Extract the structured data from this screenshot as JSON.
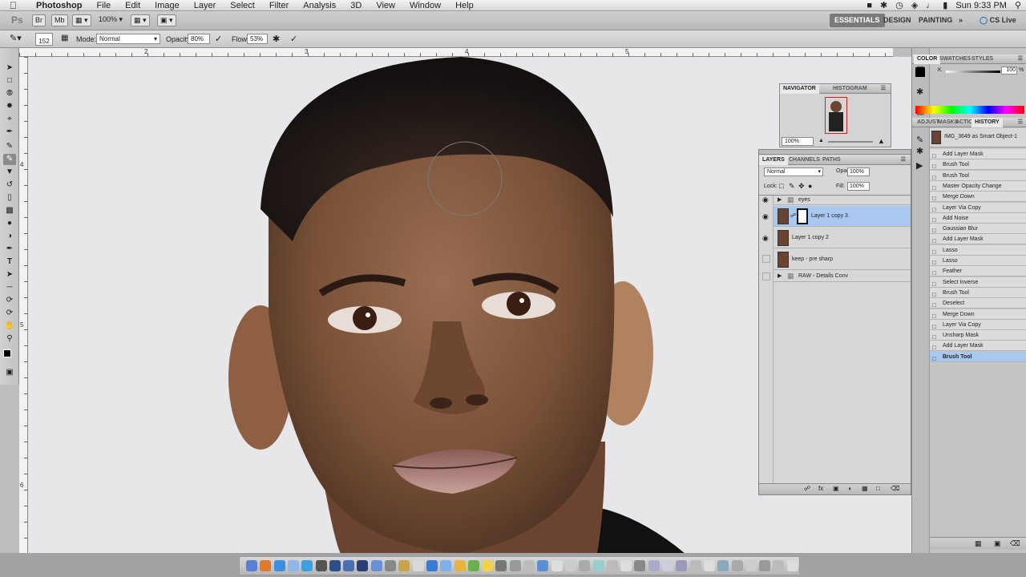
{
  "menubar": {
    "app_name": "Photoshop",
    "items": [
      "File",
      "Edit",
      "Image",
      "Layer",
      "Select",
      "Filter",
      "Analysis",
      "3D",
      "View",
      "Window",
      "Help"
    ],
    "clock": "Sun 9:33 PM"
  },
  "appbar": {
    "zoom": "100%",
    "workspaces": [
      "ESSENTIALS",
      "DESIGN",
      "PAINTING"
    ],
    "overflow": "»",
    "cs_live": "CS Live"
  },
  "options": {
    "brush_size": "152",
    "mode_label": "Mode:",
    "mode_value": "Normal",
    "opacity_label": "Opacity:",
    "opacity_value": "80%",
    "flow_label": "Flow:",
    "flow_value": "53%"
  },
  "ruler_h": [
    "2",
    "3",
    "4",
    "5"
  ],
  "ruler_v": [
    "4",
    "5",
    "6"
  ],
  "navigator": {
    "tabs": [
      "NAVIGATOR",
      "HISTOGRAM"
    ],
    "zoom": "100%"
  },
  "color_panel": {
    "tabs": [
      "COLOR",
      "SWATCHES",
      "STYLES"
    ],
    "channel": "K",
    "value": "100",
    "unit": "%"
  },
  "history_panel": {
    "tabs": [
      "ADJUST",
      "MASKS",
      "ACTION",
      "HISTORY"
    ],
    "snapshot": "IMG_3649 as Smart Object-1",
    "items": [
      "Add Layer Mask",
      "Brush Tool",
      "Brush Tool",
      "Master Opacity Change",
      "Merge Down",
      "Layer Via Copy",
      "Add Noise",
      "Gaussian Blur",
      "Add Layer Mask",
      "Lasso",
      "Lasso",
      "Feather",
      "Select Inverse",
      "Brush Tool",
      "Deselect",
      "Merge Down",
      "Layer Via Copy",
      "Unsharp Mask",
      "Add Layer Mask",
      "Brush Tool"
    ],
    "selected_index": 19
  },
  "layers_panel": {
    "tabs": [
      "LAYERS",
      "CHANNELS",
      "PATHS"
    ],
    "blend_mode": "Normal",
    "opacity_label": "Opacity:",
    "opacity_value": "100%",
    "lock_label": "Lock:",
    "fill_label": "Fill:",
    "fill_value": "100%",
    "layers": [
      {
        "name": "eyes",
        "type": "group",
        "visible": true
      },
      {
        "name": "Layer 1 copy 3",
        "type": "layer",
        "visible": true,
        "selected": true
      },
      {
        "name": "Layer 1 copy 2",
        "type": "layer",
        "visible": true
      },
      {
        "name": "keep - pre sharp",
        "type": "layer",
        "visible": false
      },
      {
        "name": "RAW - Details Conv",
        "type": "group",
        "visible": false
      }
    ]
  },
  "colors": {
    "selection": "#a9c8f0",
    "panel": "#d7d7d7",
    "canvas_bg": "#e7e7e9"
  }
}
